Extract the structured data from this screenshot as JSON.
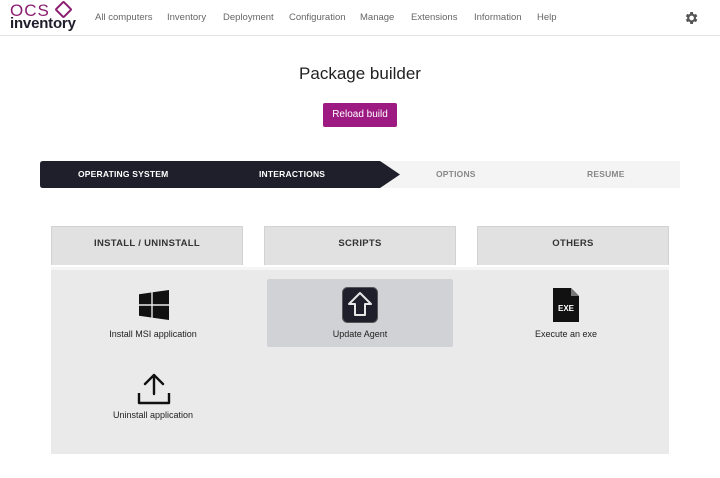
{
  "logo": {
    "top": "OCS",
    "bottom": "inventory"
  },
  "nav": {
    "items": [
      "All computers",
      "Inventory",
      "Deployment",
      "Configuration",
      "Manage",
      "Extensions",
      "Information",
      "Help"
    ]
  },
  "page": {
    "title": "Package builder",
    "reload_label": "Reload build"
  },
  "stepper": {
    "steps": [
      "OPERATING SYSTEM",
      "INTERACTIONS",
      "OPTIONS",
      "RESUME"
    ],
    "active_index": 1,
    "active_color": "#1f1f2b"
  },
  "tabs": [
    "INSTALL / UNINSTALL",
    "SCRIPTS",
    "OTHERS"
  ],
  "actions": [
    {
      "label": "Install MSI application",
      "icon": "windows-icon"
    },
    {
      "label": "Update Agent",
      "icon": "upload-arrow-icon",
      "selected": true
    },
    {
      "label": "Execute an exe",
      "icon": "exe-file-icon"
    },
    {
      "label": "Uninstall application",
      "icon": "upload-tray-icon"
    }
  ],
  "colors": {
    "brand": "#9c1a81",
    "panel": "#eaeaeb",
    "tab": "#e1e1e1"
  }
}
